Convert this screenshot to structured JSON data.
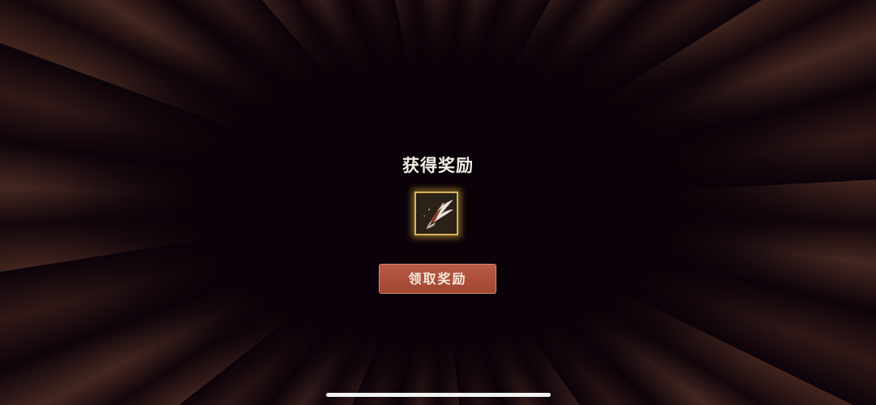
{
  "reward_popup": {
    "title": "获得奖励",
    "item_icon": "angel-wing-icon",
    "claim_button_label": "领取奖励"
  },
  "colors": {
    "button": "#a9503c",
    "item_border": "#d8b25a",
    "background": "#0c030a"
  }
}
